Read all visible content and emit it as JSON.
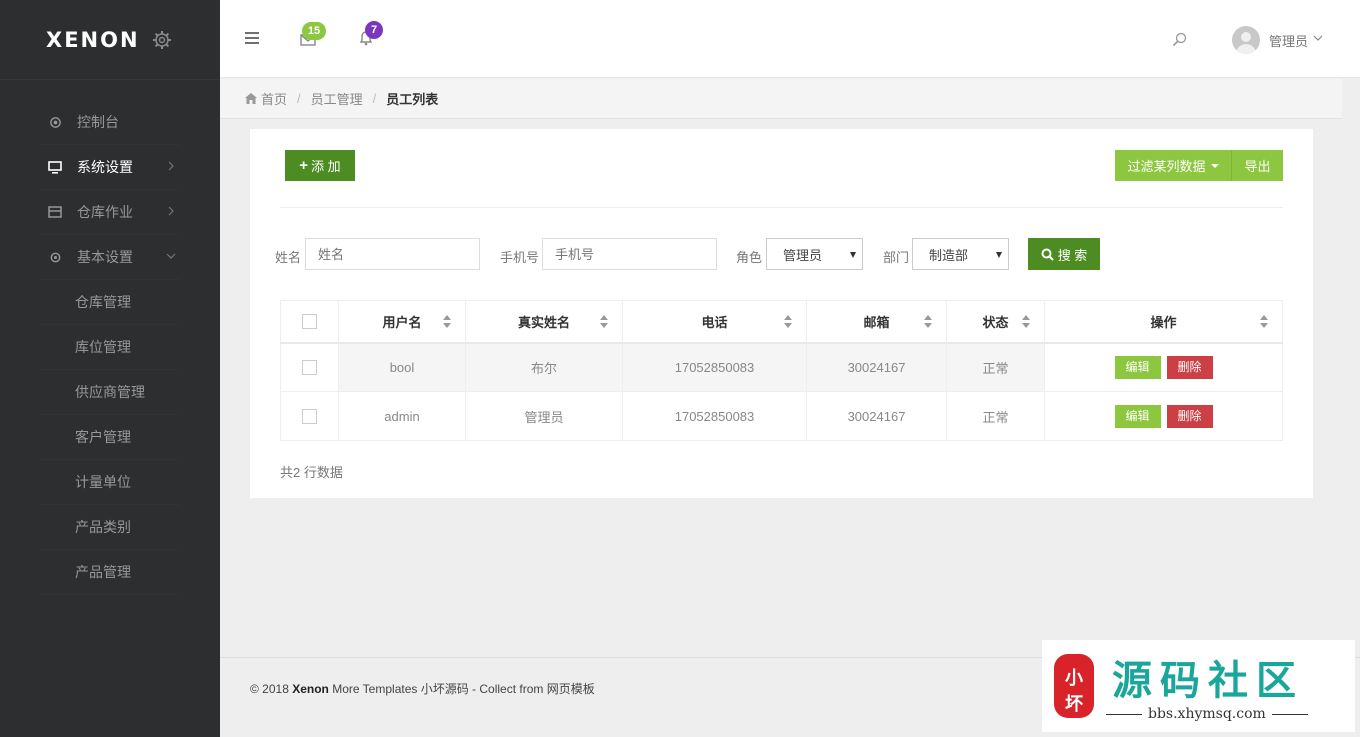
{
  "brand": {
    "logo": "XENON"
  },
  "sidebar": {
    "items": [
      {
        "label": "控制台",
        "icon": "dashboard-icon",
        "has_chevron": false
      },
      {
        "label": "系统设置",
        "icon": "monitor-icon",
        "has_chevron": true,
        "active": true
      },
      {
        "label": "仓库作业",
        "icon": "storage-icon",
        "has_chevron": true
      },
      {
        "label": "基本设置",
        "icon": "gear-icon",
        "has_chevron": true,
        "expanded": true
      }
    ],
    "sub_items": [
      "仓库管理",
      "库位管理",
      "供应商管理",
      "客户管理",
      "计量单位",
      "产品类别",
      "产品管理"
    ]
  },
  "header": {
    "mail_badge": "15",
    "bell_badge": "7",
    "user_name": "管理员"
  },
  "breadcrumb": {
    "home": "首页",
    "level1": "员工管理",
    "current": "员工列表"
  },
  "toolbar": {
    "add_label": "添 加",
    "filter_label": "过滤某列数据",
    "export_label": "导出"
  },
  "search": {
    "name_label": "姓名",
    "name_placeholder": "姓名",
    "phone_label": "手机号",
    "phone_placeholder": "手机号",
    "role_label": "角色",
    "role_value": "管理员",
    "dept_label": "部门",
    "dept_value": "制造部",
    "search_label": "搜 索"
  },
  "table": {
    "headers": [
      "用户名",
      "真实姓名",
      "电话",
      "邮箱",
      "状态",
      "操作"
    ],
    "rows": [
      {
        "username": "bool",
        "realname": "布尔",
        "phone": "17052850083",
        "email": "30024167",
        "status": "正常"
      },
      {
        "username": "admin",
        "realname": "管理员",
        "phone": "17052850083",
        "email": "30024167",
        "status": "正常"
      }
    ],
    "edit_label": "编辑",
    "delete_label": "删除",
    "count_text": "共2 行数据"
  },
  "footer": {
    "prefix": "© 2018 ",
    "brand": "Xenon",
    "suffix": " More Templates 小坏源码 - Collect from 网页模板"
  },
  "watermark": {
    "title": "源码社区",
    "url": "bbs.xhymsq.com",
    "seal_text": "小坏"
  },
  "colors": {
    "sidebar_bg": "#2c2e2f",
    "primary_green": "#4d8c23",
    "light_green": "#8dc63f",
    "danger": "#cc3f44",
    "badge_purple": "#7c38bc",
    "watermark_teal": "#1aa69a"
  }
}
